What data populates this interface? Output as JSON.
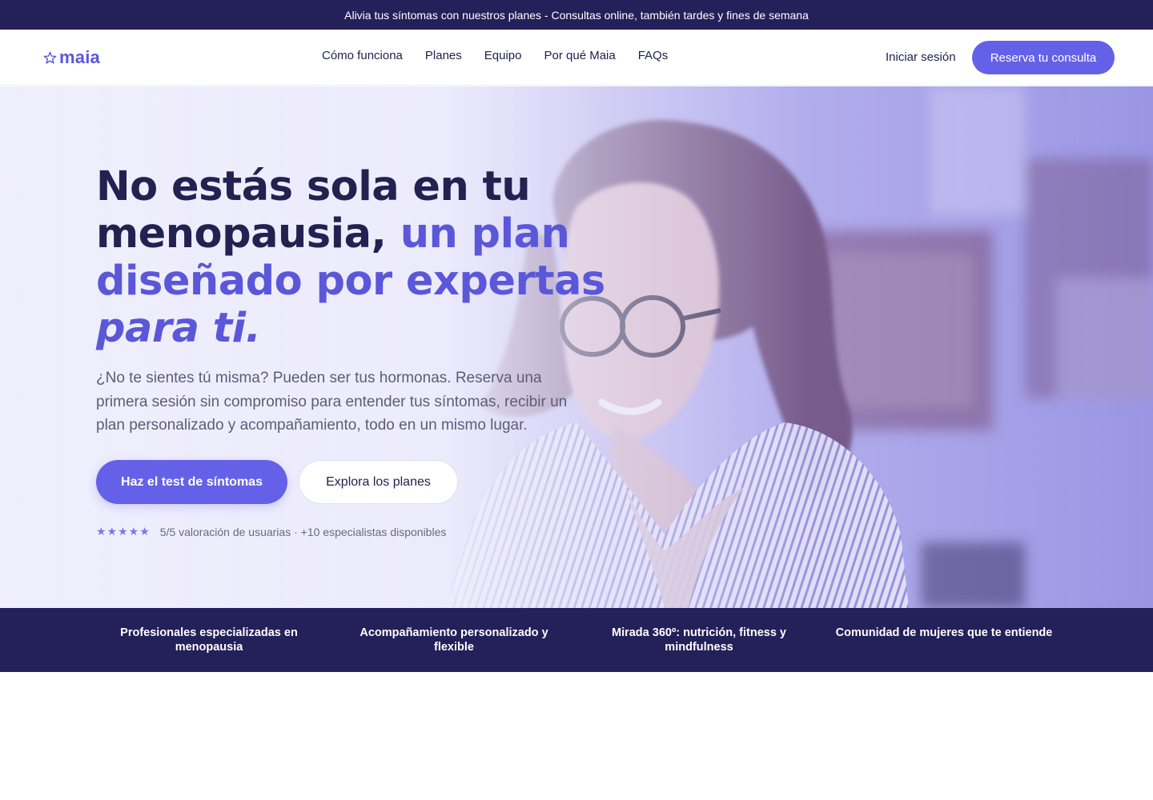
{
  "announcement": "Alivia tus síntomas con nuestros planes - Consultas online, también tardes y fines de semana",
  "nav": {
    "logo_text": "maia",
    "logo_icon": "star-outline-icon",
    "links": [
      "Cómo funciona",
      "Planes",
      "Equipo",
      "Por qué Maia",
      "FAQs"
    ],
    "login": "Iniciar sesión",
    "cta": "Reserva tu consulta"
  },
  "hero": {
    "title_line1": "No estás sola en tu",
    "title_line2_a": "menopausia, ",
    "title_line2_b": "un plan",
    "title_line3": "diseñado por expertas",
    "title_line4": "para ti.",
    "subtitle": "¿No te sientes tú misma? Pueden ser tus hormonas. Reserva una primera sesión sin compromiso para entender tus síntomas, recibir un plan personalizado y acompañamiento, todo en un mismo lugar.",
    "primary_button": "Haz el test de síntomas",
    "secondary_button": "Explora los planes",
    "stars": "★★★★★",
    "rating_text": "5/5 valoración de usuarias · +10 especialistas disponibles",
    "image_description": "smiling-woman-with-glasses-photo"
  },
  "features": [
    "Profesionales especializadas en menopausia",
    "Acompañamiento personalizado y flexible",
    "Mirada 360º: nutrición, fitness y mindfulness",
    "Comunidad de mujeres que te entiende"
  ],
  "colors": {
    "brand": "#5b57d9",
    "button": "#6461e8",
    "navy": "#23205a",
    "text": "#23214f"
  }
}
